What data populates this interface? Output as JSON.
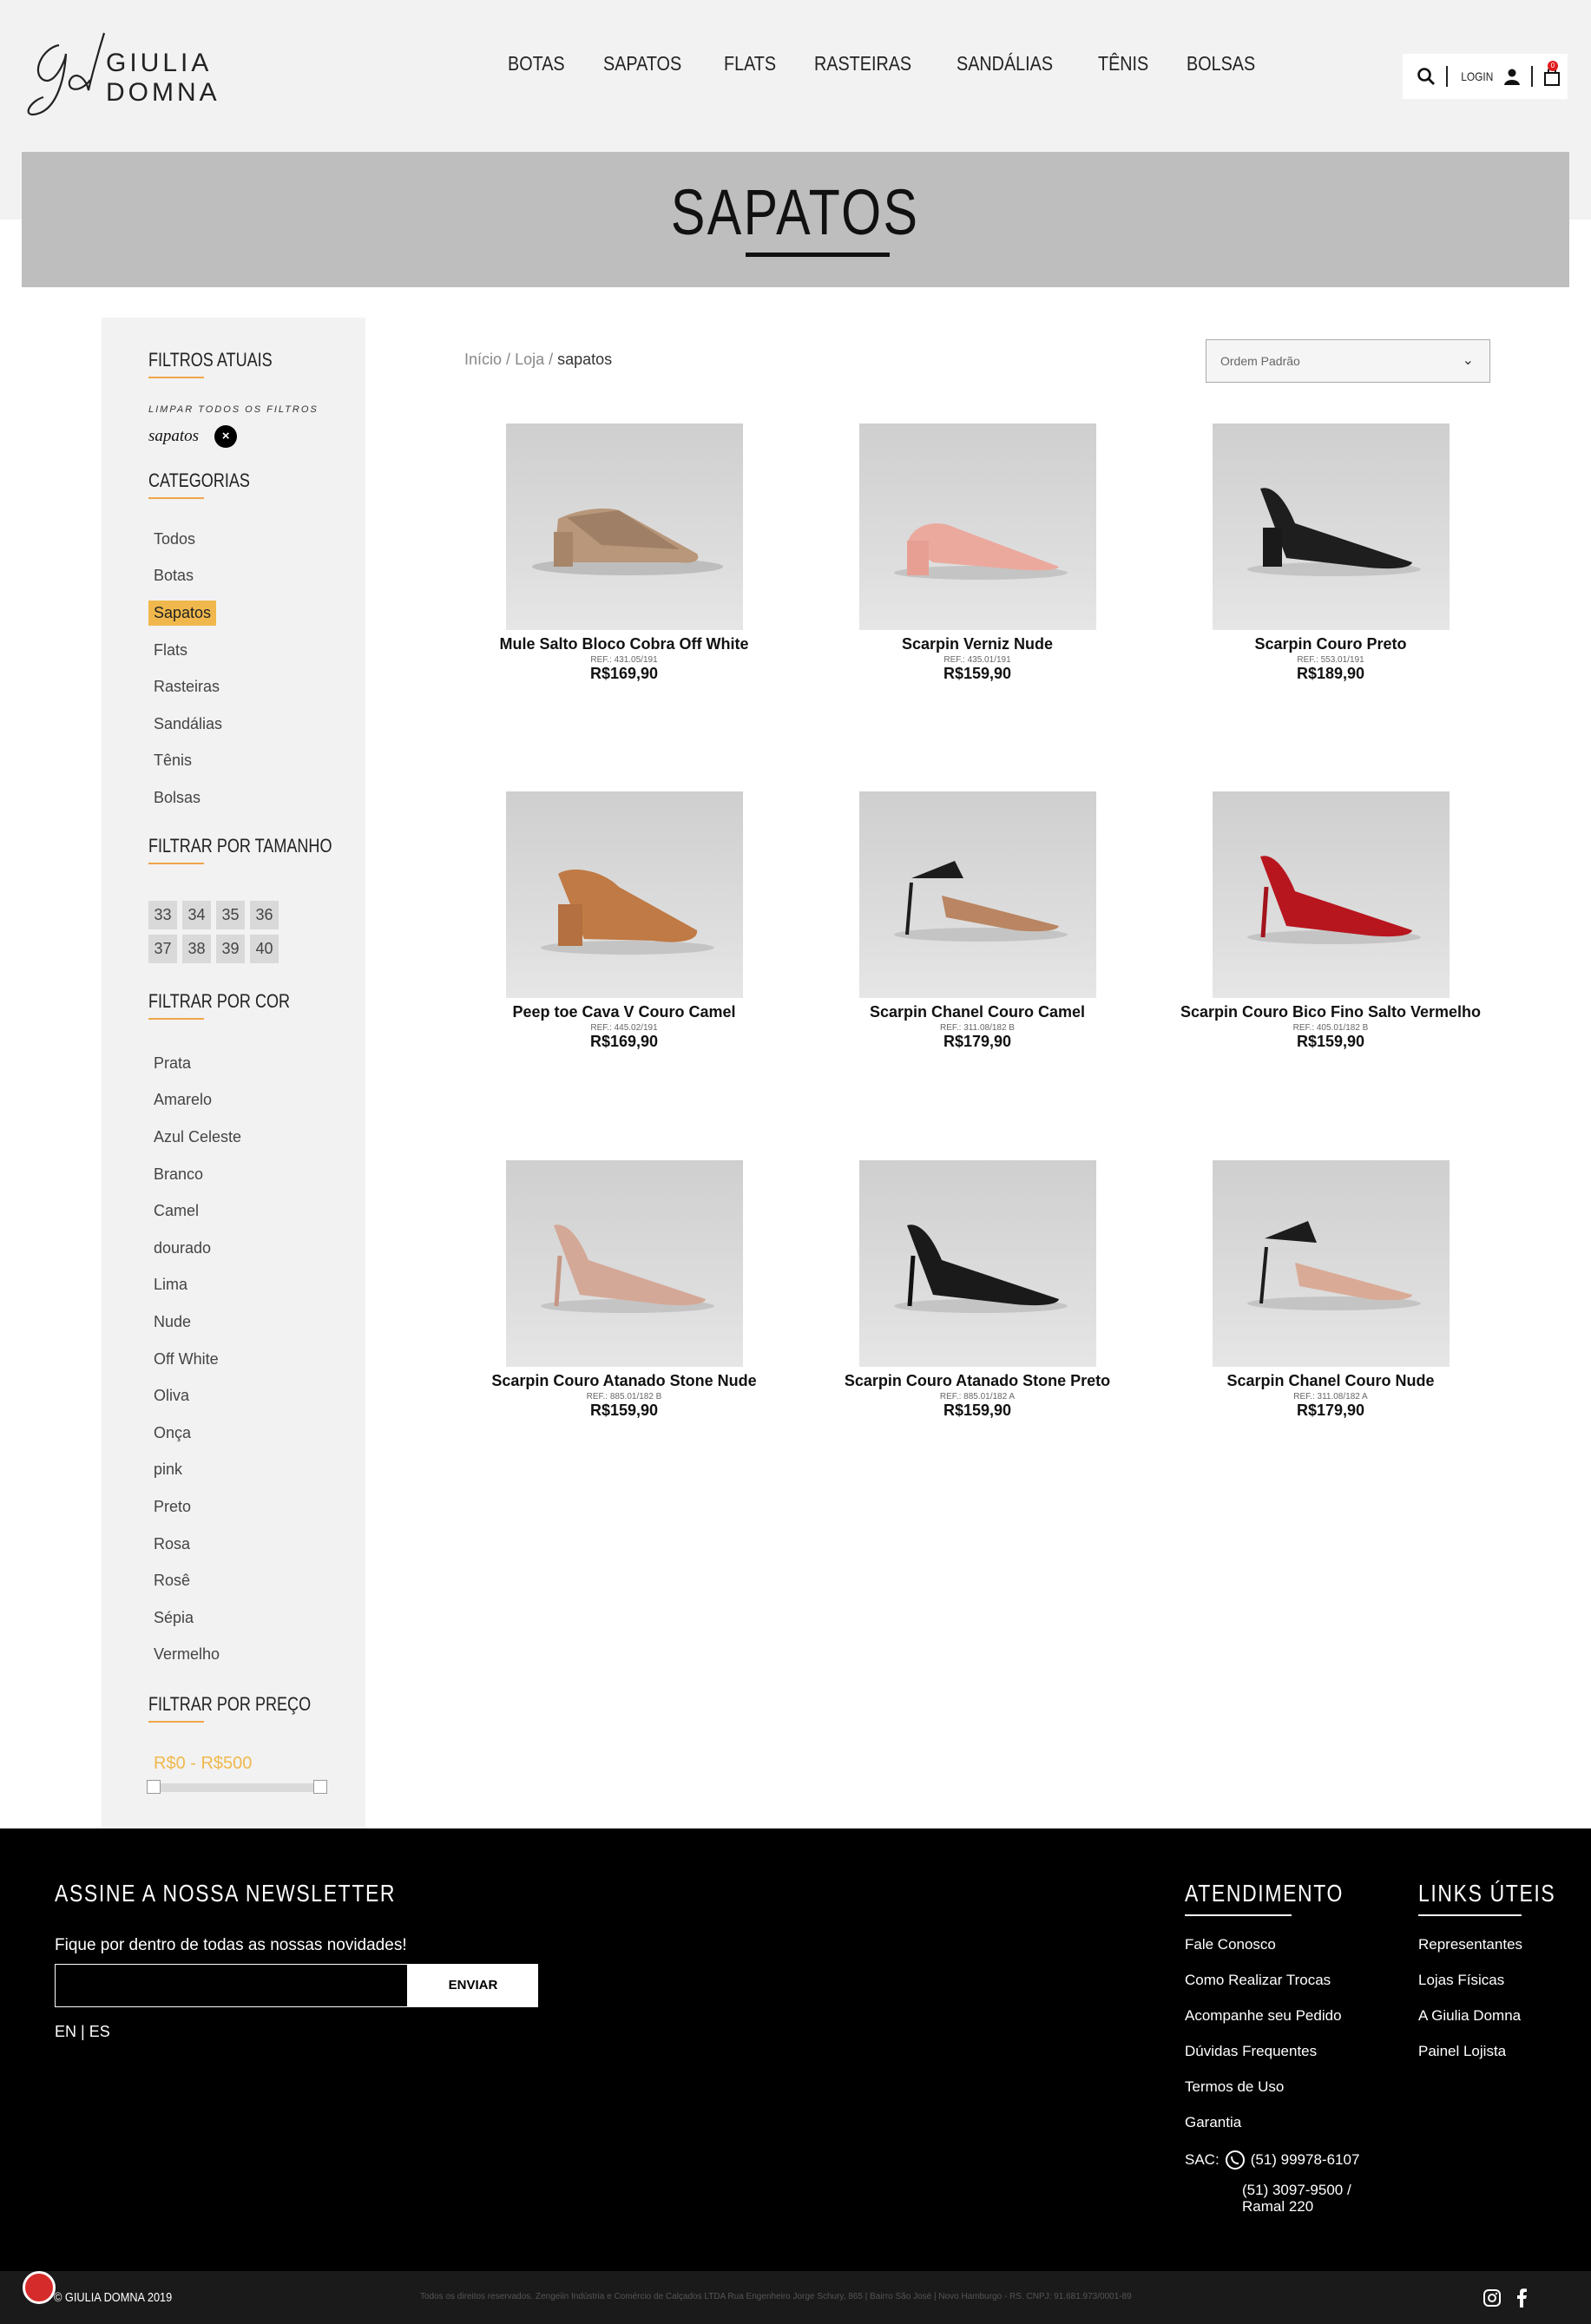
{
  "header": {
    "brand_mark": "Gd",
    "brand_name": "GIULIA DOMNA",
    "nav": [
      "BOTAS",
      "SAPATOS",
      "FLATS",
      "RASTEIRAS",
      "SANDÁLIAS",
      "TÊNIS",
      "BOLSAS"
    ],
    "login_label": "LOGIN",
    "cart_count": "0"
  },
  "banner": {
    "title": "SAPATOS"
  },
  "sidebar": {
    "current_filters_title": "FILTROS ATUAIS",
    "clear_all": "LIMPAR TODOS OS FILTROS",
    "active_filter": "sapatos",
    "categories_title": "CATEGORIAS",
    "categories": [
      "Todos",
      "Botas",
      "Sapatos",
      "Flats",
      "Rasteiras",
      "Sandálias",
      "Tênis",
      "Bolsas"
    ],
    "active_category": "Sapatos",
    "size_title": "FILTRAR POR TAMANHO",
    "sizes": [
      "33",
      "34",
      "35",
      "36",
      "37",
      "38",
      "39",
      "40"
    ],
    "color_title": "FILTRAR POR COR",
    "colors": [
      "Prata",
      "Amarelo",
      "Azul Celeste",
      "Branco",
      "Camel",
      "dourado",
      "Lima",
      "Nude",
      "Off White",
      "Oliva",
      "Onça",
      "pink",
      "Preto",
      "Rosa",
      "Rosê",
      "Sépia",
      "Vermelho"
    ],
    "price_title": "FILTRAR POR PREÇO",
    "price_range": "R$0 - R$500"
  },
  "main": {
    "breadcrumb": {
      "home": "Início",
      "shop": "Loja",
      "current": "sapatos"
    },
    "sort_label": "Ordem Padrão",
    "products": [
      {
        "name": "Mule Salto Bloco Cobra Off White",
        "ref": "REF.: 431.05/191",
        "price": "R$169,90"
      },
      {
        "name": "Scarpin Verniz Nude",
        "ref": "REF.: 435.01/191",
        "price": "R$159,90"
      },
      {
        "name": "Scarpin Couro Preto",
        "ref": "REF.: 553.01/191",
        "price": "R$189,90"
      },
      {
        "name": "Peep toe Cava V Couro Camel",
        "ref": "REF.: 445.02/191",
        "price": "R$169,90"
      },
      {
        "name": "Scarpin Chanel Couro Camel",
        "ref": "REF.: 311.08/182 B",
        "price": "R$179,90"
      },
      {
        "name": "Scarpin Couro Bico Fino Salto Vermelho",
        "ref": "REF.: 405.01/182 B",
        "price": "R$159,90"
      },
      {
        "name": "Scarpin Couro Atanado Stone Nude",
        "ref": "REF.: 885.01/182 B",
        "price": "R$159,90"
      },
      {
        "name": "Scarpin Couro Atanado Stone Preto",
        "ref": "REF.: 885.01/182 A",
        "price": "R$159,90"
      },
      {
        "name": "Scarpin Chanel Couro Nude",
        "ref": "REF.: 311.08/182 A",
        "price": "R$179,90"
      }
    ]
  },
  "footer": {
    "newsletter_title": "ASSINE A NOSSA NEWSLETTER",
    "newsletter_text": "Fique por dentro de todas as nossas novidades!",
    "send_label": "ENVIAR",
    "lang_en": "EN",
    "lang_es": "ES",
    "service_title": "ATENDIMENTO",
    "service_links": [
      "Fale Conosco",
      "Como Realizar Trocas",
      "Acompanhe seu Pedido",
      "Dúvidas Frequentes",
      "Termos de Uso",
      "Garantia"
    ],
    "sac_label": "SAC:",
    "sac_whatsapp": "(51) 99978-6107",
    "sac_phone_1": "(51) 3097-9500 /",
    "sac_phone_2": "Ramal 220",
    "useful_title": "LINKS ÚTEIS",
    "useful_links": [
      "Representantes",
      "Lojas Físicas",
      "A Giulia Domna",
      "Painel Lojista"
    ],
    "copyright": "© GIULIA DOMNA 2019",
    "legal": "Todos os direitos reservados. Zengeiin Indústria e Comércio de Calçados LTDA Rua Engenheiro Jorge Schury, 865 | Bairro São José | Novo Hamburgo - RS. CNPJ: 91.681.973/0001-89"
  },
  "colors": {
    "accent": "#f0b84c",
    "banner": "#bebebe",
    "footer": "#000000"
  }
}
